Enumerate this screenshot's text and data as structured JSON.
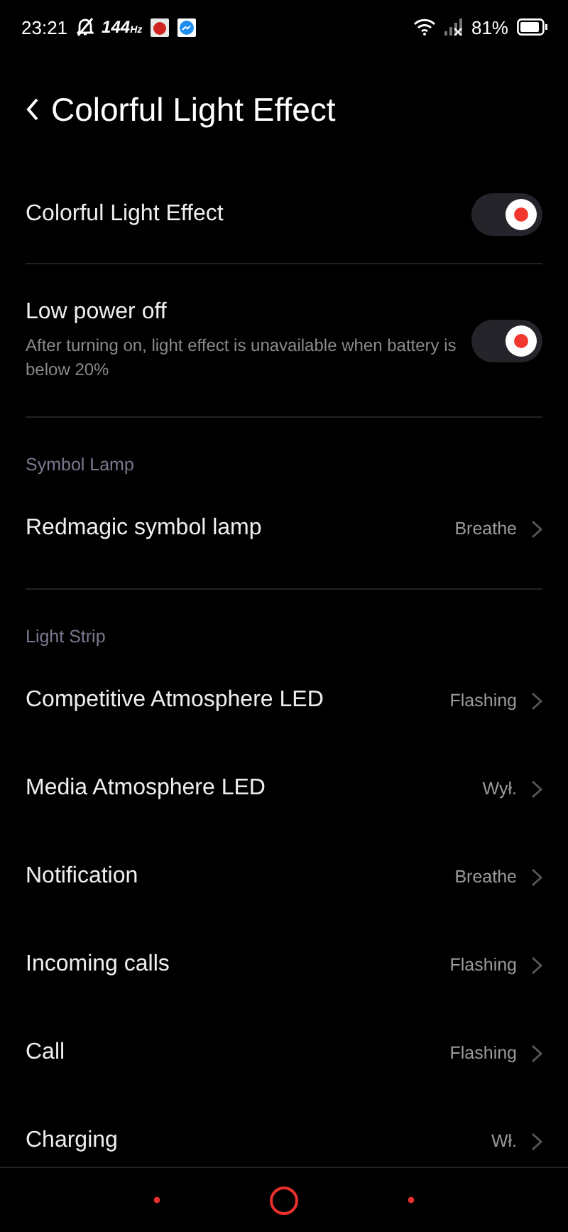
{
  "status_bar": {
    "time": "23:21",
    "refresh_rate": "144",
    "refresh_unit": "Hz",
    "battery": "81%"
  },
  "header": {
    "title": "Colorful Light Effect"
  },
  "sections": [
    {
      "items": [
        {
          "kind": "toggle",
          "label": "Colorful Light Effect",
          "on": true
        },
        {
          "kind": "toggle",
          "label": "Low power off",
          "description": "After turning on, light effect is unavailable when battery is below 20%",
          "on": true
        }
      ]
    },
    {
      "title": "Symbol Lamp",
      "items": [
        {
          "kind": "link",
          "label": "Redmagic symbol lamp",
          "value": "Breathe"
        }
      ]
    },
    {
      "title": "Light Strip",
      "items": [
        {
          "kind": "link",
          "label": "Competitive Atmosphere LED",
          "value": "Flashing"
        },
        {
          "kind": "link",
          "label": "Media Atmosphere LED",
          "value": "Wył."
        },
        {
          "kind": "link",
          "label": "Notification",
          "value": "Breathe"
        },
        {
          "kind": "link",
          "label": "Incoming calls",
          "value": "Flashing"
        },
        {
          "kind": "link",
          "label": "Call",
          "value": "Flashing"
        },
        {
          "kind": "link",
          "label": "Charging",
          "value": "Wł."
        }
      ]
    }
  ]
}
